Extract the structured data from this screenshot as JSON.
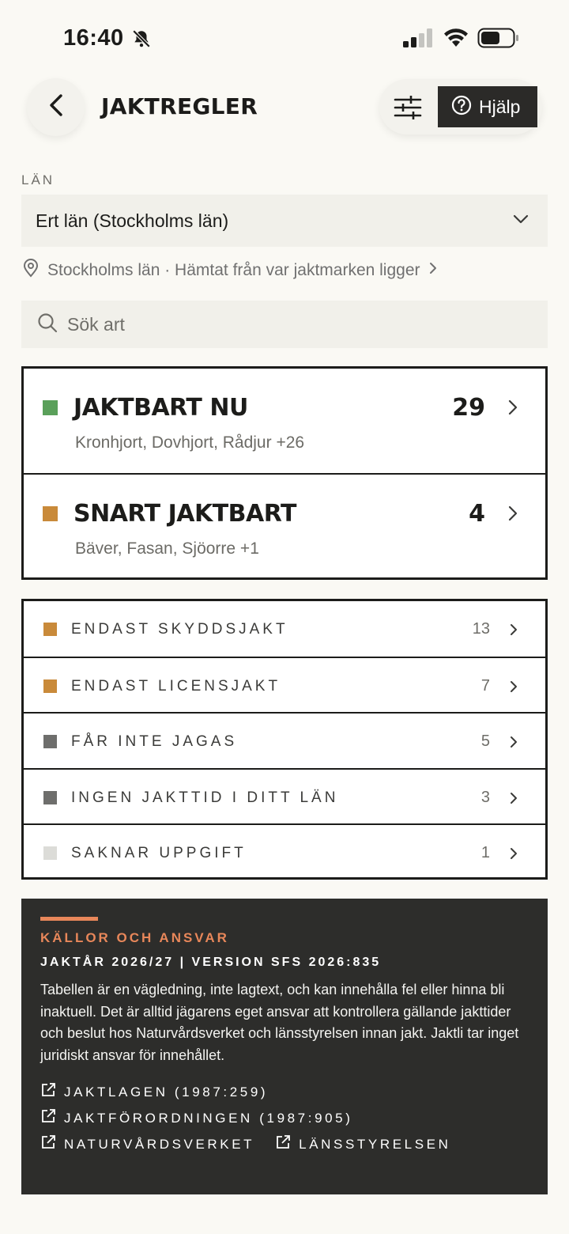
{
  "status_bar": {
    "time": "16:40",
    "icons": [
      "bell-slash-icon",
      "signal-icon",
      "wifi-icon",
      "battery-icon"
    ]
  },
  "header": {
    "title": "JAKTREGLER",
    "back_icon": "chevron-left-icon",
    "filter_icon": "sliders-icon",
    "help_icon": "question-circle-icon",
    "help_label": "Hjälp"
  },
  "county": {
    "label": "LÄN",
    "selected": "Ert län (Stockholms län)",
    "location_hint": "Stockholms län · Hämtat från var jaktmarken ligger"
  },
  "search": {
    "placeholder": "Sök art",
    "value": ""
  },
  "status_groups": [
    {
      "title": "JAKTBART NU",
      "count": "29",
      "examples": "Kronhjort, Dovhjort, Rådjur +26",
      "color": "#5aa05a"
    },
    {
      "title": "SNART JAKTBART",
      "count": "4",
      "examples": "Bäver, Fasan, Sjöorre +1",
      "color": "#c98a3a"
    }
  ],
  "categories": [
    {
      "label": "ENDAST SKYDDSJAKT",
      "count": "13",
      "color": "#c98a3a"
    },
    {
      "label": "ENDAST LICENSJAKT",
      "count": "7",
      "color": "#c98a3a"
    },
    {
      "label": "FÅR INTE JAGAS",
      "count": "5",
      "color": "#6e6e6c"
    },
    {
      "label": "INGEN JAKTTID I DITT LÄN",
      "count": "3",
      "color": "#6e6e6c"
    },
    {
      "label": "SAKNAR UPPGIFT",
      "count": "1",
      "color": "#dcdcd8"
    }
  ],
  "disclaimer": {
    "heading": "KÄLLOR OCH ANSVAR",
    "subheading": "JAKTÅR 2026/27 | VERSION SFS 2026:835",
    "text": "Tabellen är en vägledning, inte lagtext, och kan innehålla fel eller hinna bli inaktuell. Det är alltid jägarens eget ansvar att kontrollera gällande jakttider och beslut hos Naturvårdsverket och länsstyrelsen innan jakt. Jaktli tar inget juridiskt ansvar för innehållet.",
    "links": [
      "JAKTLAGEN (1987:259)",
      "JAKTFÖRORDNINGEN (1987:905)",
      "NATURVÅRDSVERKET",
      "LÄNSSTYRELSEN"
    ],
    "accent_color": "#e8875a"
  }
}
